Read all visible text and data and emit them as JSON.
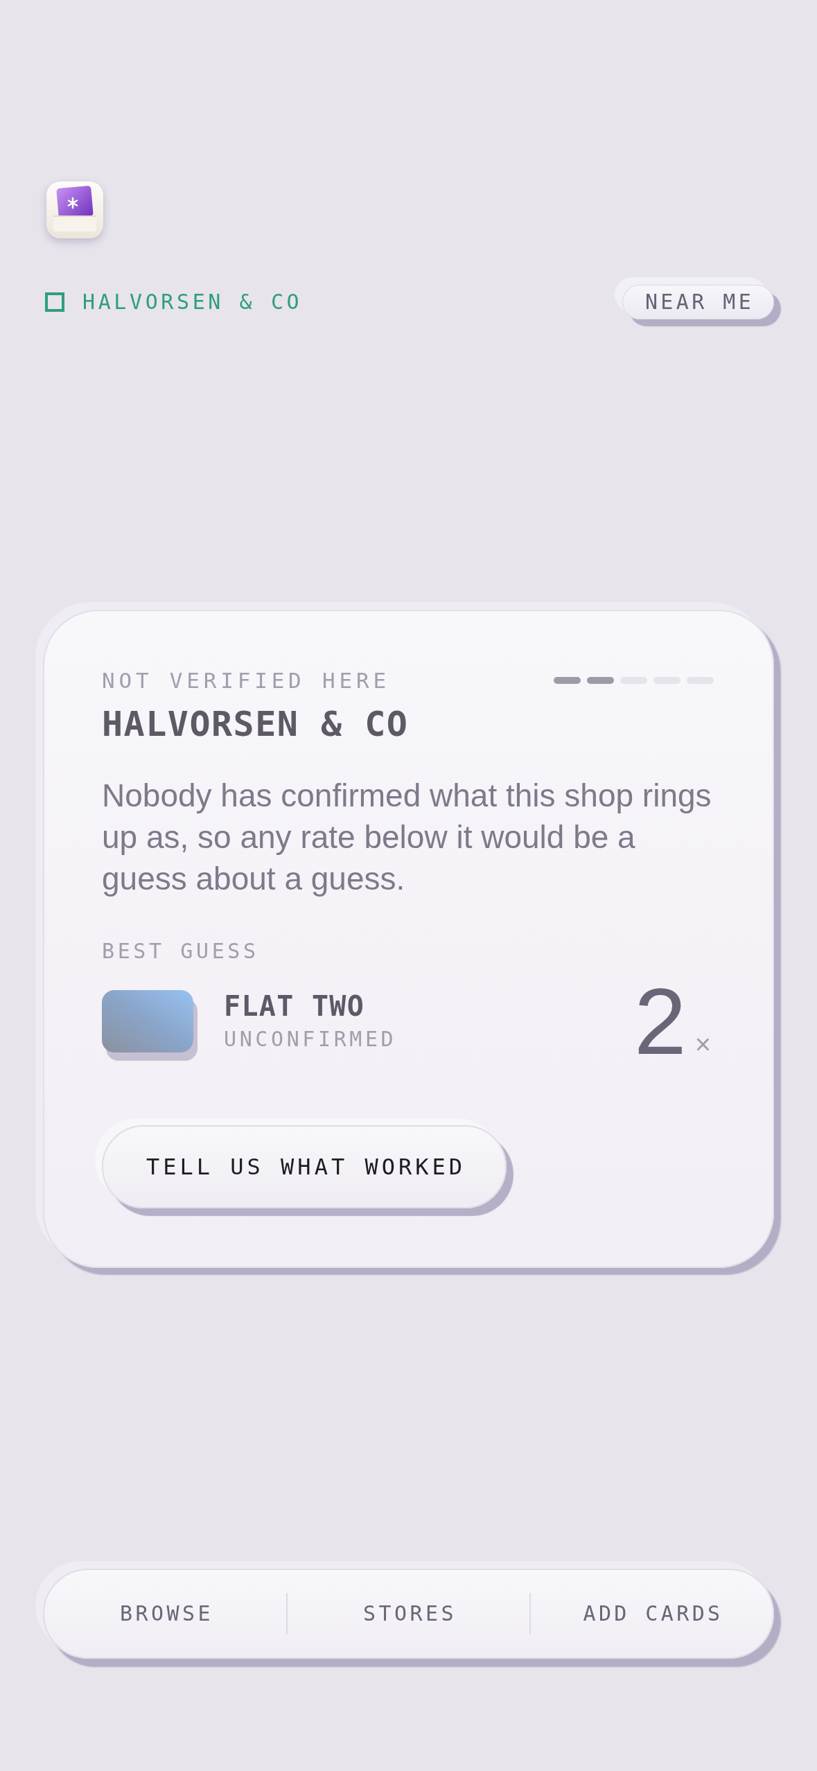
{
  "header": {
    "store_name": "HALVORSEN & CO",
    "location_button": "NEAR ME"
  },
  "card": {
    "eyebrow": "NOT VERIFIED HERE",
    "steps": [
      {
        "filled": true
      },
      {
        "filled": true
      },
      {
        "filled": false
      },
      {
        "filled": false
      },
      {
        "filled": false
      }
    ],
    "title": "HALVORSEN & CO",
    "description": "Nobody has confirmed what this shop rings up as, so any rate below it would be a guess about a guess.",
    "section_label": "BEST GUESS",
    "best_guess": {
      "name": "FLAT TWO",
      "status": "UNCONFIRMED",
      "rate": "2",
      "unit": "×"
    },
    "action": "TELL US WHAT WORKED"
  },
  "nav": [
    {
      "label": "BROWSE"
    },
    {
      "label": "STORES"
    },
    {
      "label": "ADD CARDS"
    }
  ]
}
